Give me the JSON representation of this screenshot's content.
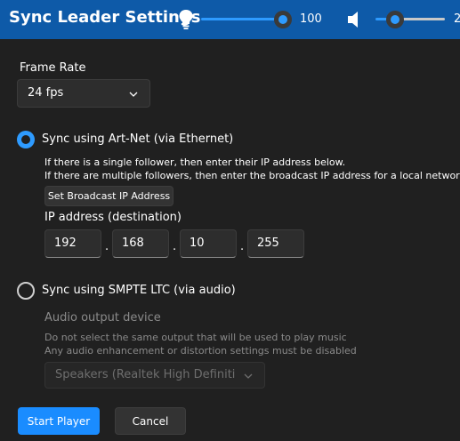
{
  "header": {
    "title": "Sync Leader Settings",
    "brightness": {
      "value_label": "100",
      "level": 1.0
    },
    "volume": {
      "value_label": "2",
      "level": 0.25
    }
  },
  "frame_rate": {
    "label": "Frame Rate",
    "selected": "24 fps"
  },
  "artnet": {
    "label": "Sync using Art-Net  (via Ethernet)",
    "selected": true,
    "info_line1": "If there is a single follower, then enter their IP address below.",
    "info_line2": "If there are multiple followers, then enter the broadcast IP address for a local network.",
    "broadcast_button": "Set Broadcast IP Address",
    "ip_label": "IP address (destination)",
    "ip_octets": [
      "192",
      "168",
      "10",
      "255"
    ],
    "separator": "."
  },
  "smpte": {
    "label": "Sync using SMPTE LTC (via audio)",
    "selected": false,
    "device_label": "Audio output device",
    "warning_line1": "Do not select the same output that will be used to play music",
    "warning_line2": "Any audio enhancement or distortion settings must be disabled",
    "device_selected": "Speakers (Realtek High Definiti"
  },
  "actions": {
    "start": "Start Player",
    "cancel": "Cancel"
  },
  "colors": {
    "titlebar": "#0e5aa8",
    "accent": "#2e9bff",
    "background": "#202020"
  }
}
